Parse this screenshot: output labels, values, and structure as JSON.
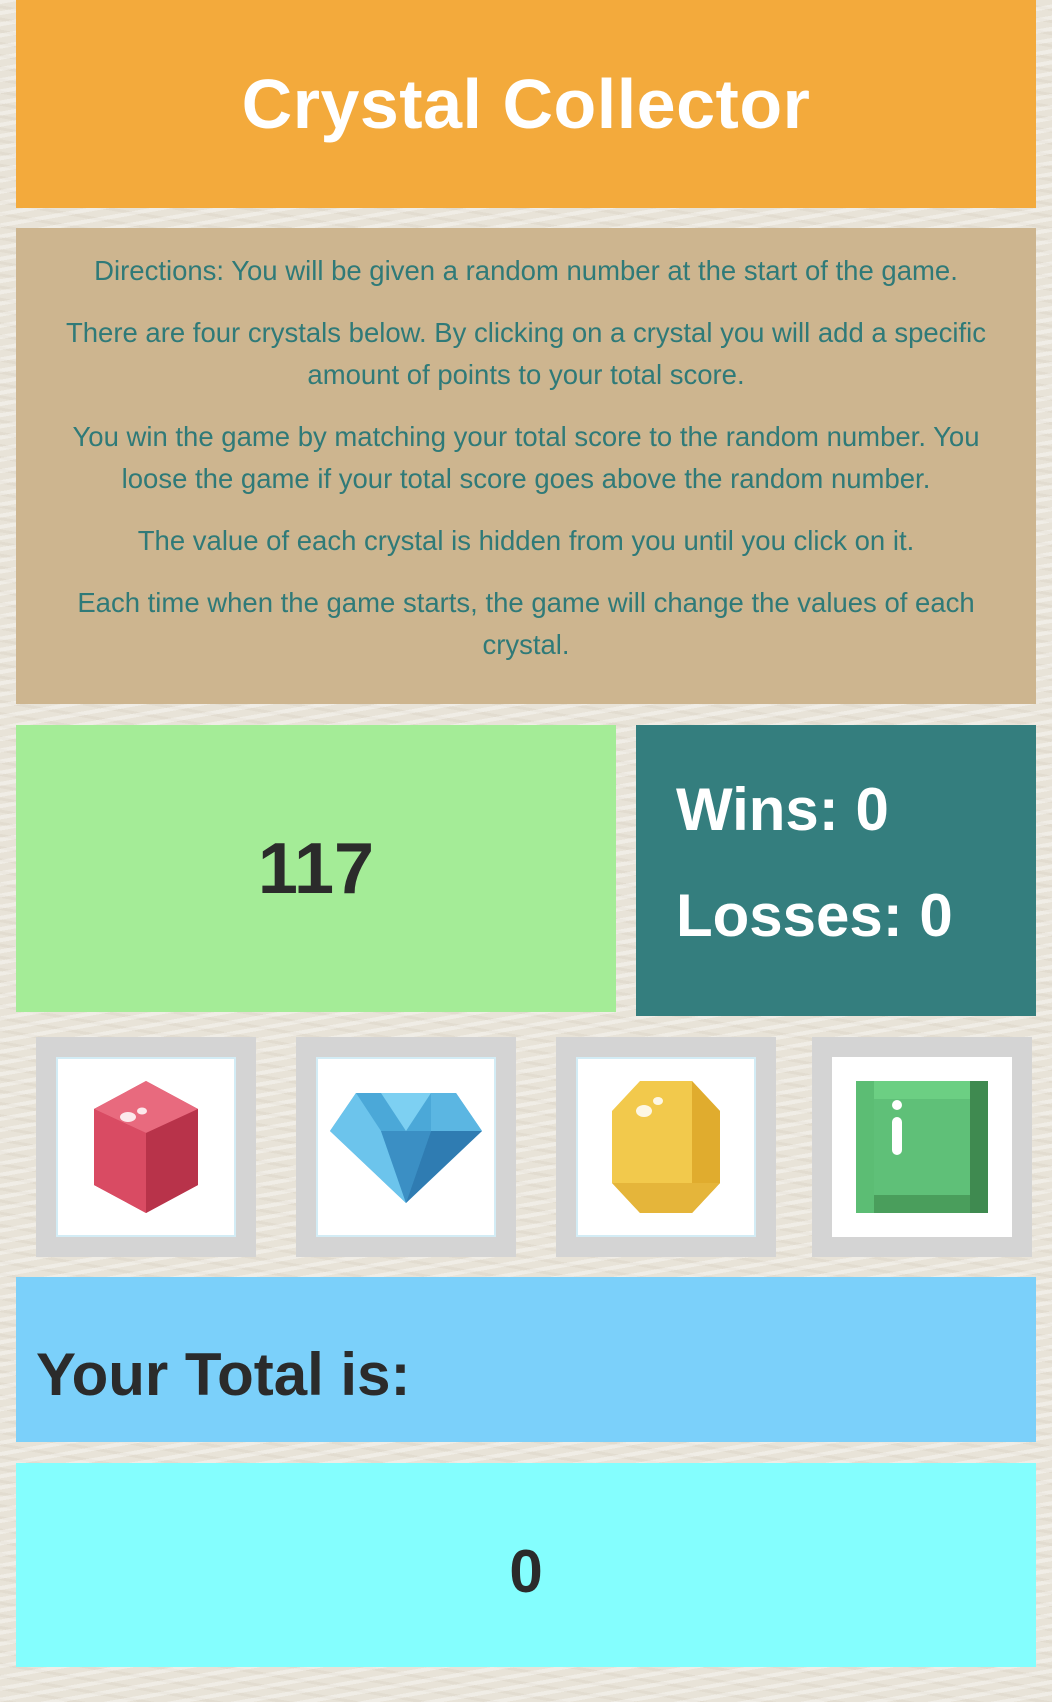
{
  "header": {
    "title": "Crystal Collector"
  },
  "directions": {
    "paragraphs": [
      "Directions: You will be given a random number at the start of the game.",
      "There are four crystals below. By clicking on a crystal you will add a specific amount of points to your total score.",
      "You win the game by matching your total score to the random number. You loose the game if your total score goes above the random number.",
      "The value of each crystal is hidden from you until you click on it.",
      "Each time when the game starts, the game will change the values of each crystal."
    ]
  },
  "game": {
    "target_number": "117",
    "wins_label": "Wins: 0",
    "losses_label": "Losses: 0"
  },
  "crystals": [
    {
      "icon": "red-ruby-icon",
      "color": "#d6485f"
    },
    {
      "icon": "blue-diamond-icon",
      "color": "#4ba8d8"
    },
    {
      "icon": "yellow-gem-icon",
      "color": "#f2c94c"
    },
    {
      "icon": "green-emerald-icon",
      "color": "#5cbd74"
    }
  ],
  "total": {
    "label": "Your Total is:",
    "value": "0"
  },
  "colors": {
    "header": "#f3aa3c",
    "directions_bg": "#cdb58f",
    "directions_text": "#2f7a78",
    "target_bg": "#a4ec97",
    "score_bg": "#347e7e",
    "total_label_bg": "#7bd0fa",
    "total_value_bg": "#84fefe"
  }
}
